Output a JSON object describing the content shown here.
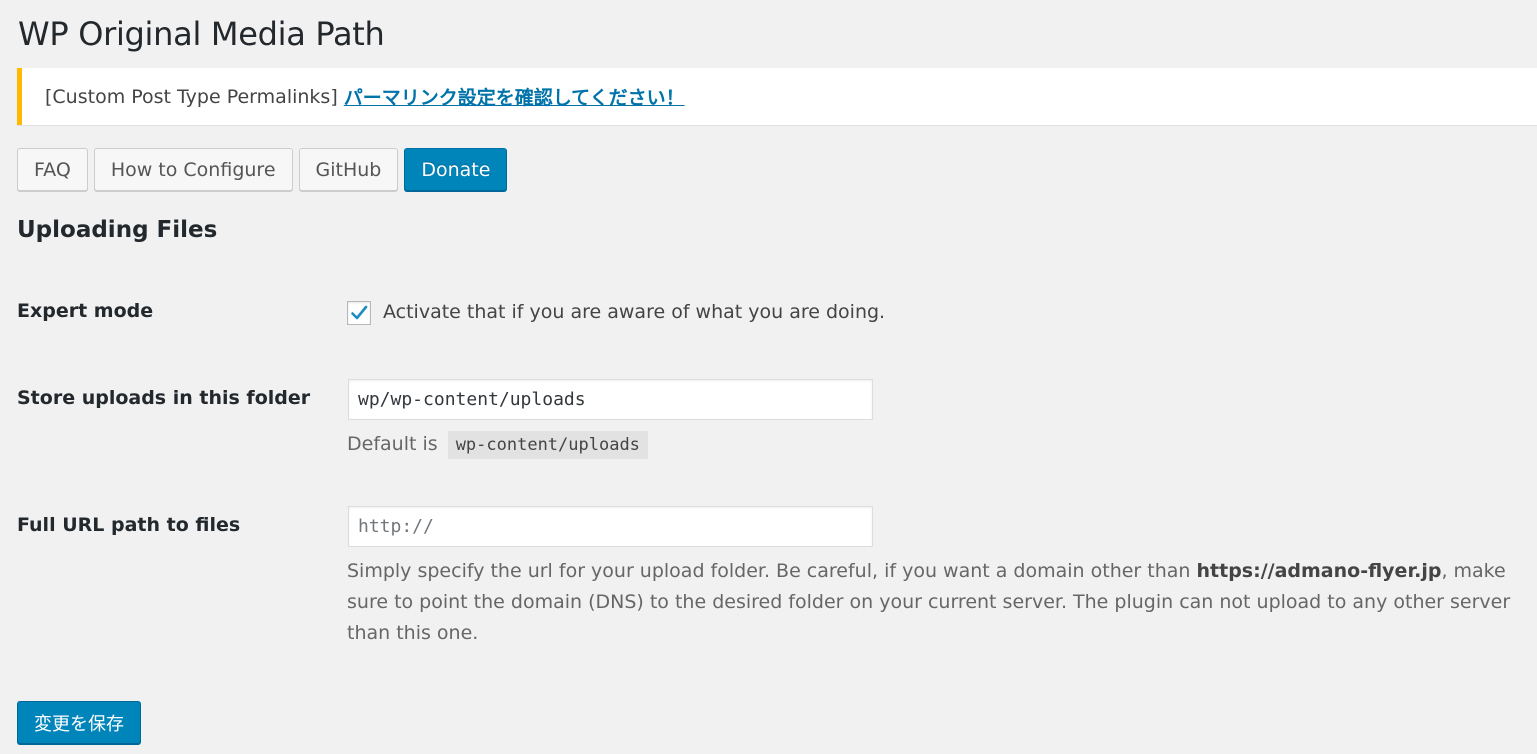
{
  "page_title": "WP Original Media Path",
  "notice": {
    "prefix": "[Custom Post Type Permalinks]",
    "link": "パーマリンク設定を確認してください！",
    "accent_color": "#ffb900"
  },
  "buttons": {
    "faq": "FAQ",
    "configure": "How to Configure",
    "github": "GitHub",
    "donate": "Donate"
  },
  "section_title": "Uploading Files",
  "expert_mode": {
    "label": "Expert mode",
    "checked": true,
    "description": "Activate that if you are aware of what you are doing."
  },
  "store_uploads": {
    "label": "Store uploads in this folder",
    "value": "wp/wp-content/uploads",
    "default_prefix": "Default is",
    "default_code": "wp-content/uploads"
  },
  "full_url": {
    "label": "Full URL path to files",
    "placeholder": "http://",
    "desc_part1": "Simply specify the url for your upload folder. Be careful, if you want a domain other than",
    "desc_domain": "https://admano-flyer.jp",
    "desc_part2": ", make sure to point the domain (DNS) to the desired folder on your current server. The plugin can not upload to any other server than this one."
  },
  "save_button": "変更を保存",
  "colors": {
    "primary": "#0085ba",
    "link": "#0073aa",
    "background": "#f1f1f1"
  }
}
